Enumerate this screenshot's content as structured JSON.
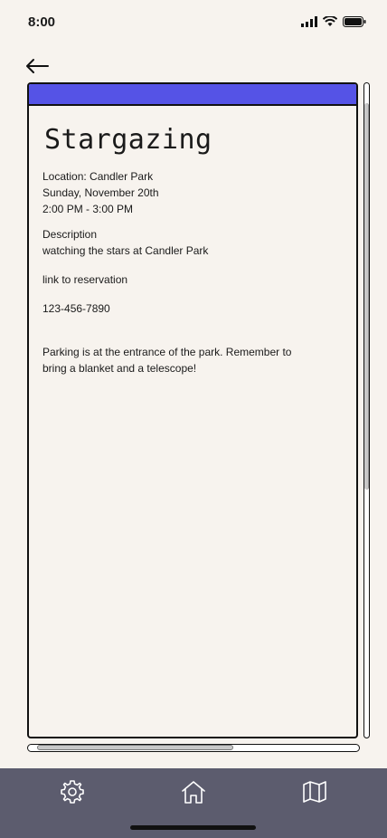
{
  "status": {
    "time": "8:00"
  },
  "event": {
    "title": "Stargazing",
    "location": "Location: Candler Park",
    "date": "Sunday, November 20th",
    "time": "2:00 PM - 3:00 PM",
    "description_label": "Description",
    "description": "watching the stars at Candler Park",
    "reservation_link": "link to reservation",
    "phone": "123-456-7890",
    "note_line1": "Parking is at the entrance of the park. Remember to",
    "note_line2": "bring a blanket and a telescope!"
  },
  "colors": {
    "header": "#5553e6",
    "tab_bar": "#5c5c6e",
    "background": "#f7f3ee"
  },
  "icons": {
    "back": "arrow-left-icon",
    "settings": "gear-icon",
    "home": "home-icon",
    "map": "map-icon"
  }
}
